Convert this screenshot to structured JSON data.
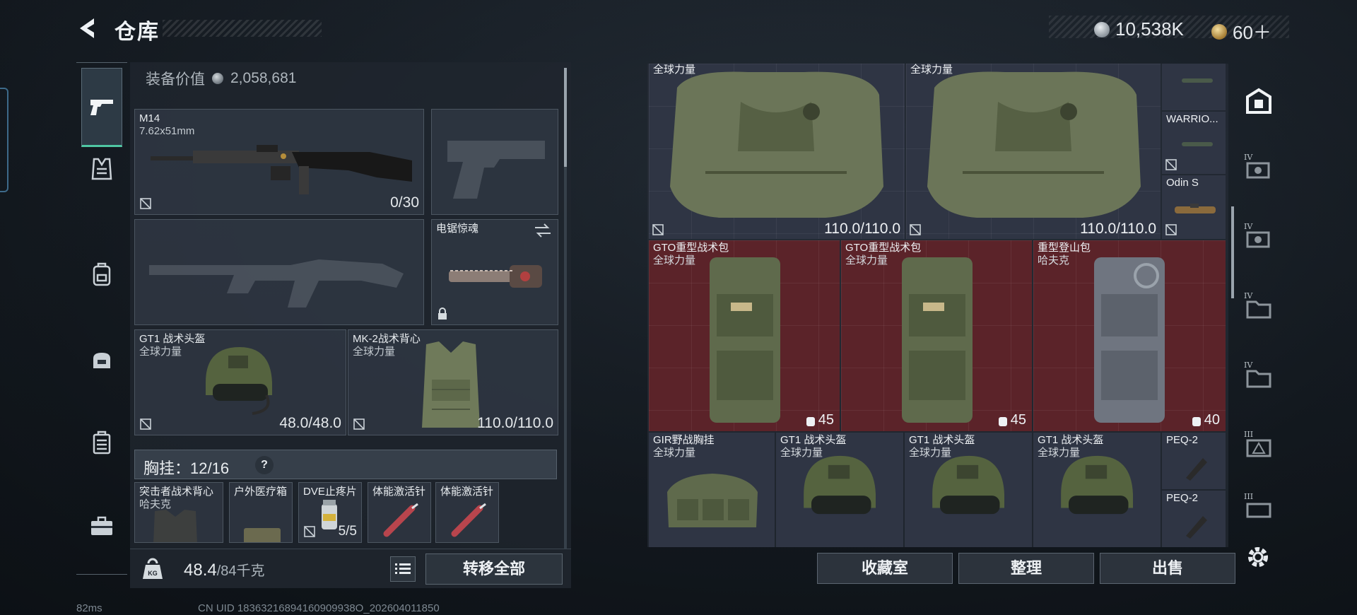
{
  "header": {
    "title": "仓库",
    "currency_silver": "10,538K",
    "currency_gold": "60＋"
  },
  "left_panel": {
    "equip_value_label": "装备价值",
    "equip_value": "2,058,681",
    "primary_weapon": {
      "name": "M14",
      "caliber": "7.62x51mm",
      "ammo": "0/30"
    },
    "melee": {
      "name": "电锯惊魂"
    },
    "helmet": {
      "name": "GT1 战术头盔",
      "maker": "全球力量",
      "durability": "48.0/48.0"
    },
    "armor": {
      "name": "MK-2战术背心",
      "maker": "全球力量",
      "durability": "110.0/110.0"
    },
    "chest_rig": {
      "label": "胸挂：12/16",
      "help": "?"
    },
    "rig_items": [
      {
        "name": "突击者战术背心",
        "maker": "哈夫克"
      },
      {
        "name": "户外医疗箱"
      },
      {
        "name": "DVE止疼片",
        "count": "5/5"
      },
      {
        "name": "体能激活针"
      },
      {
        "name": "体能激活针"
      }
    ]
  },
  "bottom_left": {
    "weight": "48.4",
    "weight_max": "/84千克",
    "transfer_all": "转移全部"
  },
  "stash": {
    "row1": [
      {
        "maker": "全球力量",
        "durability": "110.0/110.0"
      },
      {
        "maker": "全球力量",
        "durability": "110.0/110.0"
      }
    ],
    "side_items": [
      {
        "name": ""
      },
      {
        "name": "WARRIO..."
      },
      {
        "name": "Odin S"
      }
    ],
    "row2": [
      {
        "name": "GTO重型战术包",
        "maker": "全球力量",
        "count": "45"
      },
      {
        "name": "GTO重型战术包",
        "maker": "全球力量",
        "count": "45"
      },
      {
        "name": "重型登山包",
        "maker": "哈夫克",
        "count": "40"
      }
    ],
    "row3": [
      {
        "name": "GIR野战胸挂",
        "maker": "全球力量"
      },
      {
        "name": "GT1 战术头盔",
        "maker": "全球力量"
      },
      {
        "name": "GT1 战术头盔",
        "maker": "全球力量"
      },
      {
        "name": "GT1 战术头盔",
        "maker": "全球力量"
      }
    ],
    "peq": [
      {
        "name": "PEQ-2"
      },
      {
        "name": "PEQ-2"
      }
    ]
  },
  "categories": [
    {
      "tier": "IV"
    },
    {
      "tier": "IV"
    },
    {
      "tier": "IV"
    },
    {
      "tier": "IV"
    },
    {
      "tier": "III"
    },
    {
      "tier": "III"
    }
  ],
  "bottom_right": {
    "collection": "收藏室",
    "sort": "整理",
    "sell": "出售"
  },
  "status": {
    "ping": "82ms",
    "uid": "CN UID 18363216894160909938O_202604011850"
  },
  "colors": {
    "accent_green": "#4fc7a3",
    "red_cell": "#5e242a",
    "dark_cell": "#2f3544"
  }
}
